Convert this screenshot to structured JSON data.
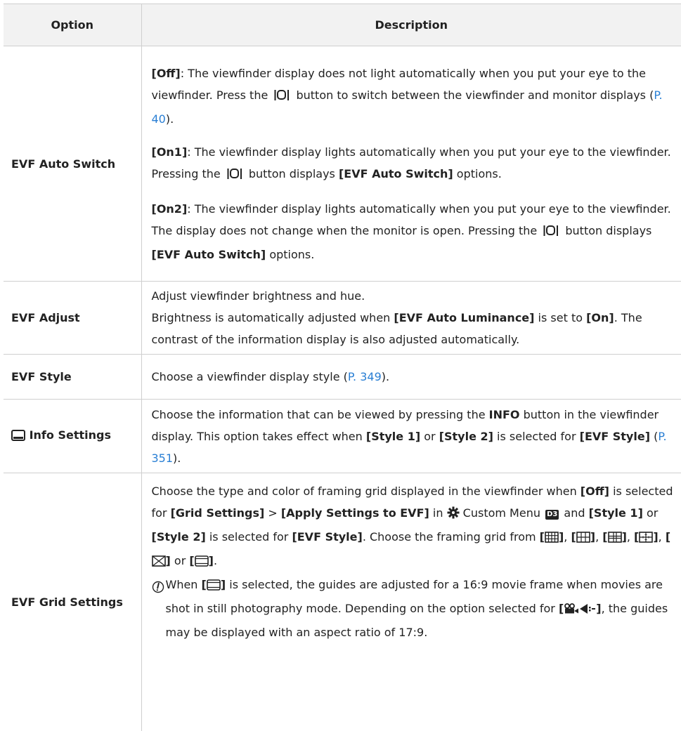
{
  "table": {
    "headers": {
      "option": "Option",
      "description": "Description"
    },
    "rows": [
      {
        "option": "EVF Auto Switch",
        "paragraphs": [
          {
            "b1": "[Off]",
            "t1": ": The viewfinder display does not light automatically when you put your eye to the viewfinder. Press the ",
            "t2": " button to switch between the viewfinder and monitor displays (",
            "link": "P. 40",
            "t3": ")."
          },
          {
            "b1": "[On1]",
            "t1": ": The viewfinder display lights automatically when you put your eye to the viewfinder. Pressing the ",
            "t2": " button displays ",
            "b2": "[EVF Auto Switch]",
            "t3": " options."
          },
          {
            "b1": "[On2]",
            "t1": ": The viewfinder display lights automatically when you put your eye to the viewfinder. The display does not change when the monitor is open. Pressing the ",
            "t2": " button displays ",
            "b2": "[EVF Auto Switch]",
            "t3": " options."
          }
        ]
      },
      {
        "option": "EVF Adjust",
        "line1": "Adjust viewfinder brightness and hue.",
        "t1": "Brightness is automatically adjusted when ",
        "b1": "[EVF Auto Luminance]",
        "t2": " is set to ",
        "b2": "[On]",
        "t3": ". The contrast of the information display is also adjusted automatically."
      },
      {
        "option": "EVF Style",
        "t1": "Choose a viewfinder display style (",
        "link": "P. 349",
        "t2": ")."
      },
      {
        "option": "Info Settings",
        "icon": "monitor-info-icon",
        "t1": "Choose the information that can be viewed by pressing the ",
        "b1": "INFO",
        "t2": " button in the viewfinder display. This option takes effect when ",
        "b2": "[Style 1]",
        "t3": " or ",
        "b3": "[Style 2]",
        "t4": " is selected for ",
        "b4": "[EVF Style]",
        "t5": " (",
        "link": "P. 351",
        "t6": ")."
      },
      {
        "option": "EVF Grid Settings",
        "t1": "Choose the type and color of framing grid displayed in the viewfinder when ",
        "b1": "[Off]",
        "t2": " is selected for ",
        "b2": "[Grid Settings]",
        "t3": " > ",
        "b3": "[Apply Settings to EVF]",
        "t4": " in ",
        "t5": " Custom Menu ",
        "menu_badge": "D3",
        "t6": " and ",
        "b4": "[Style 1]",
        "t7": " or ",
        "b5": "[Style 2]",
        "t8": " is selected for ",
        "b6": "[EVF Style]",
        "t9": ". Choose the framing grid from ",
        "grid_sep1": ", ",
        "grid_sep2": " or ",
        "grid_end": ".",
        "note": {
          "t1": "When ",
          "t2": " is selected, the guides are adjusted for a 16:9 movie frame when movies are shot in still photography mode. Depending on the option selected for ",
          "t3": ", the guides may be displayed with an aspect ratio of 17:9."
        }
      }
    ]
  }
}
